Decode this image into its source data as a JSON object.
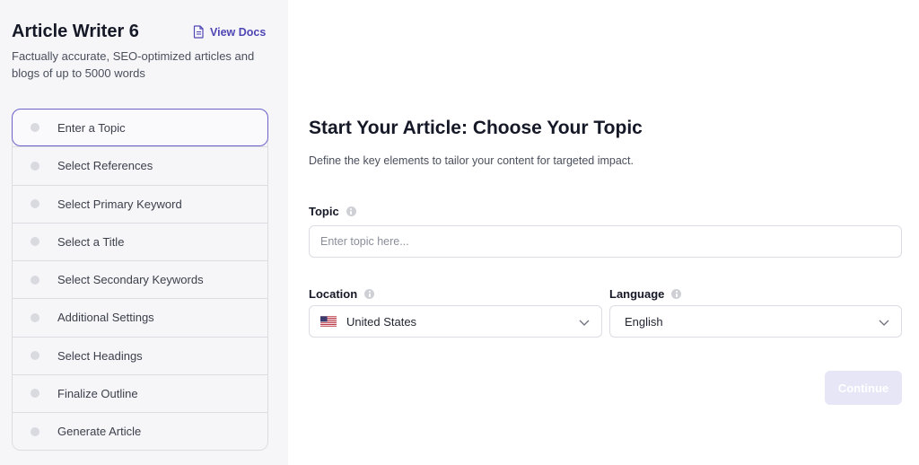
{
  "sidebar": {
    "title": "Article Writer 6",
    "docs_link": "View Docs",
    "description": "Factually accurate, SEO-optimized articles and blogs of up to 5000 words",
    "steps": [
      {
        "label": "Enter a Topic",
        "active": true
      },
      {
        "label": "Select References",
        "active": false
      },
      {
        "label": "Select Primary Keyword",
        "active": false
      },
      {
        "label": "Select a Title",
        "active": false
      },
      {
        "label": "Select Secondary Keywords",
        "active": false
      },
      {
        "label": "Additional Settings",
        "active": false
      },
      {
        "label": "Select Headings",
        "active": false
      },
      {
        "label": "Finalize Outline",
        "active": false
      },
      {
        "label": "Generate Article",
        "active": false
      }
    ]
  },
  "main": {
    "heading": "Start Your Article: Choose Your Topic",
    "subtitle": "Define the key elements to tailor your content for targeted impact.",
    "topic": {
      "label": "Topic",
      "value": "",
      "placeholder": "Enter topic here..."
    },
    "location": {
      "label": "Location",
      "value": "United States",
      "flag_icon": "us-flag-icon"
    },
    "language": {
      "label": "Language",
      "value": "English"
    },
    "continue_label": "Continue"
  },
  "colors": {
    "accent": "#4f46b5",
    "active_border": "#6b63c9",
    "sidebar_bg": "#f6f6f9",
    "button_disabled_bg": "#e7e6f6"
  }
}
